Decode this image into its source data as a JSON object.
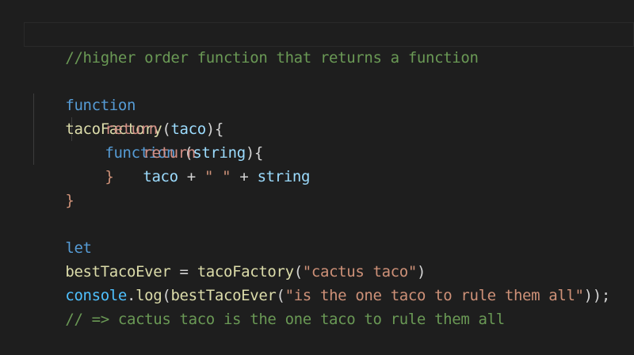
{
  "editor": {
    "lines": {
      "comment1": "//higher order function that returns a function",
      "l2": {
        "kw": "function",
        "name": "tacoFactory",
        "open": "(",
        "param": "taco",
        "close": "){"
      },
      "l3": {
        "kw": "return",
        "kw2": "function",
        "open": " (",
        "param": "string",
        "close": "){"
      },
      "l4": {
        "kw": "return",
        "a": "taco",
        "plus1": " + ",
        "str": "\" \"",
        "plus2": " + ",
        "b": "string"
      },
      "l5": "}",
      "l6": "}",
      "l8": {
        "kw": "let",
        "name": "bestTacoEver",
        "eq": " = ",
        "call": "tacoFactory",
        "open": "(",
        "str": "\"cactus taco\"",
        "close": ")"
      },
      "l10": {
        "obj": "console",
        "dot": ".",
        "method": "log",
        "open": "(",
        "call": "bestTacoEver",
        "open2": "(",
        "str": "\"is the one taco to rule them all\"",
        "close": "));"
      },
      "comment2": "// => cactus taco is the one taco to rule them all"
    }
  }
}
